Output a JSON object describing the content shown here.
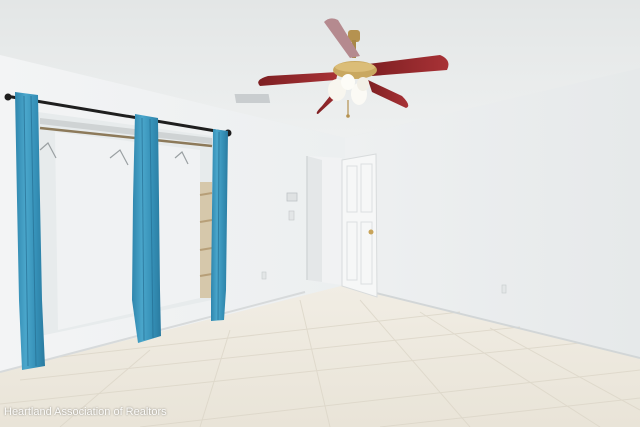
{
  "photo": {
    "watermark": "Heartland Association of Realtors"
  }
}
